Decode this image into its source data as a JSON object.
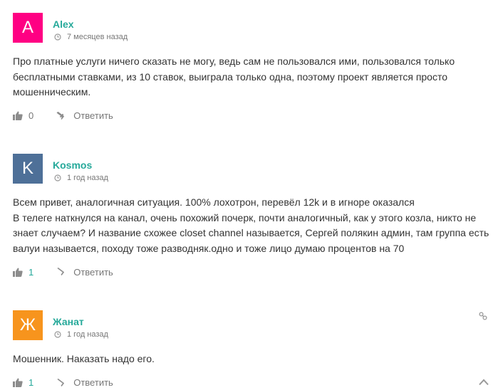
{
  "comments": [
    {
      "avatar_letter": "A",
      "avatar_color": "#ff0083",
      "author": "Alex",
      "date": "7 месяцев назад",
      "text": "Про платные услуги ничего сказать не могу, ведь сам не пользовался ими, пользовался только бесплатными ставками, из 10 ставок, выиграла только одна, поэтому проект является просто мошенническим.",
      "likes": "0",
      "reply_label": "Ответить"
    },
    {
      "avatar_letter": "K",
      "avatar_color": "#4e7098",
      "author": "Kosmos",
      "date": "1 год назад",
      "text_lines": [
        "Всем привет, аналогичная ситуация. 100% лохотрон, перевёл 12k и в игноре оказался",
        "В телеге наткнулся на канал, очень похожий почерк, почти аналогичный, как у этого козла, никто не знает случаем? И название схожее closet channel называется, Сергей полякин админ, там группа есть валуи называется, походу тоже разводняк.одно и тоже лицо думаю процентов на 70"
      ],
      "likes": "1",
      "reply_label": "Ответить"
    },
    {
      "avatar_letter": "Ж",
      "avatar_color": "#f7941d",
      "author": "Жанат",
      "date": "1 год назад",
      "text": "Мошенник. Наказать надо его.",
      "likes": "1",
      "reply_label": "Ответить"
    }
  ],
  "colors": {
    "accent": "#26a99a",
    "muted": "#777777",
    "text": "#333333"
  },
  "icons": {
    "clock": "clock-icon",
    "like": "thumbs-up-icon",
    "reply": "reply-arrow-icon",
    "link": "link-icon",
    "scroll": "chevron-up-icon"
  }
}
